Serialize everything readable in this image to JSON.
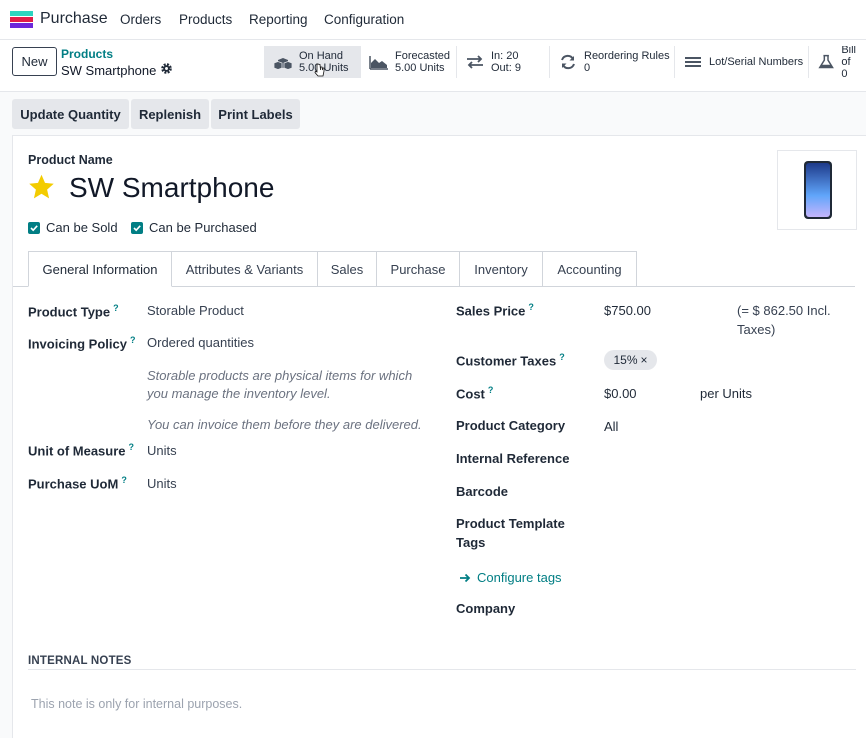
{
  "navbar": {
    "app_name": "Purchase",
    "menu": [
      "Orders",
      "Products",
      "Reporting",
      "Configuration"
    ]
  },
  "control": {
    "new_label": "New",
    "breadcrumb_parent": "Products",
    "breadcrumb_current": "SW Smartphone",
    "smart_buttons": [
      {
        "label": "On Hand",
        "value": "5.00 Units",
        "icon": "cubes-icon"
      },
      {
        "label": "Forecasted",
        "value": "5.00 Units",
        "icon": "area-chart-icon"
      },
      {
        "label": "In: 20",
        "value": "Out: 9",
        "icon": "exchange-icon"
      },
      {
        "label": "Reordering Rules",
        "value": "0",
        "icon": "refresh-icon"
      },
      {
        "label": "Lot/Serial Numbers",
        "value": "",
        "icon": "bars-icon"
      },
      {
        "label": "Bill of",
        "value": "0",
        "icon": "flask-icon"
      }
    ]
  },
  "actions": [
    "Update Quantity",
    "Replenish",
    "Print Labels"
  ],
  "product": {
    "name_label": "Product Name",
    "name": "SW Smartphone",
    "can_be_sold": "Can be Sold",
    "can_be_purchased": "Can be Purchased"
  },
  "tabs": [
    "General Information",
    "Attributes & Variants",
    "Sales",
    "Purchase",
    "Inventory",
    "Accounting"
  ],
  "left_fields": {
    "product_type_label": "Product Type",
    "product_type": "Storable Product",
    "invoicing_policy_label": "Invoicing Policy",
    "invoicing_policy": "Ordered quantities",
    "note_storable_1": "Storable products are physical items for which",
    "note_storable_2": "you manage the inventory level.",
    "note_invoice": "You can invoice them before they are delivered.",
    "uom_label": "Unit of Measure",
    "uom": "Units",
    "purchase_uom_label": "Purchase UoM",
    "purchase_uom": "Units"
  },
  "right_fields": {
    "sales_price_label": "Sales Price",
    "sales_price": "$750.00",
    "incl_taxes_1": "(= $ 862.50 Incl.",
    "incl_taxes_2": "Taxes)",
    "customer_taxes_label": "Customer Taxes",
    "customer_tax_tag": "15%",
    "tag_remove": "×",
    "cost_label": "Cost",
    "cost": "$0.00",
    "cost_unit": "per Units",
    "category_label": "Product Category",
    "category": "All",
    "internal_ref_label": "Internal Reference",
    "barcode_label": "Barcode",
    "template_tags_label_1": "Product Template",
    "template_tags_label_2": "Tags",
    "configure_tags": "Configure tags",
    "company_label": "Company"
  },
  "help_mark": "?",
  "notes": {
    "title": "INTERNAL NOTES",
    "placeholder": "This note is only for internal purposes."
  },
  "colors": {
    "accent": "#017e84",
    "star": "#f3cc00"
  }
}
